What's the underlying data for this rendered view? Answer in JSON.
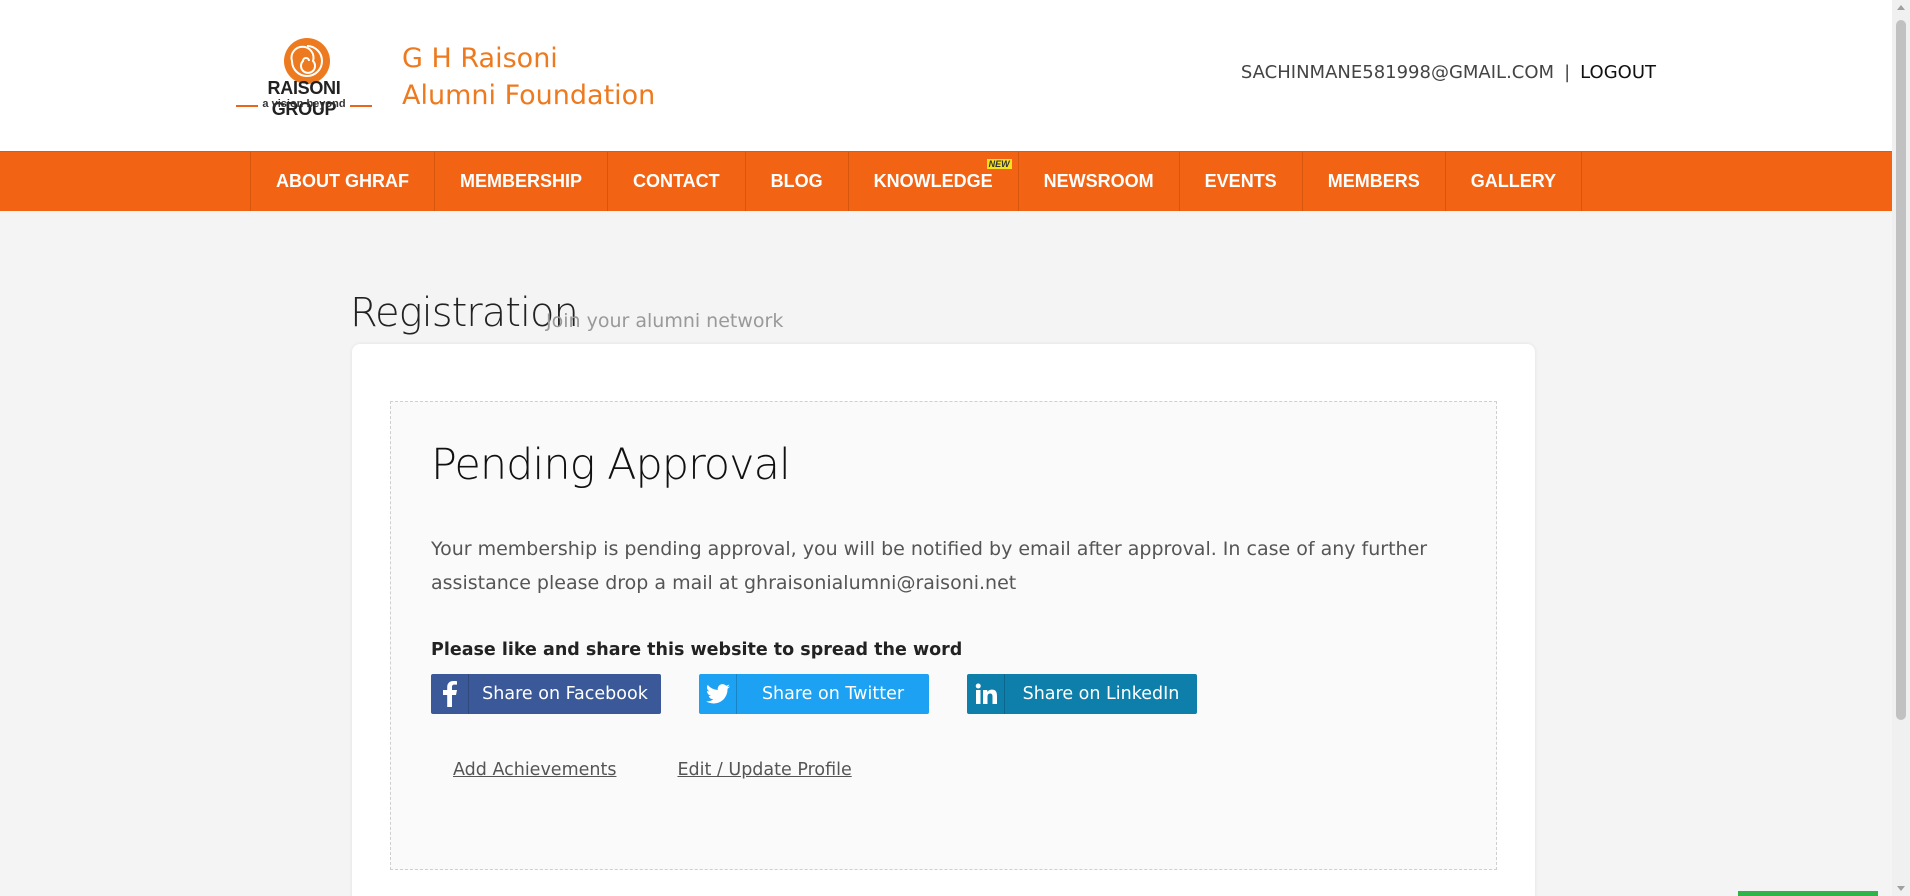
{
  "header": {
    "logo_group": "RAISONI GROUP",
    "logo_tagline": "a vision beyond",
    "brand_line1": "G H Raisoni",
    "brand_line2": "Alumni Foundation",
    "user_email": "SACHINMANE581998@GMAIL.COM",
    "separator": "|",
    "logout_label": "LOGOUT"
  },
  "nav": {
    "items": [
      {
        "label": "ABOUT GHRAF"
      },
      {
        "label": "MEMBERSHIP"
      },
      {
        "label": "CONTACT"
      },
      {
        "label": "BLOG"
      },
      {
        "label": "KNOWLEDGE",
        "badge": "NEW"
      },
      {
        "label": "NEWSROOM"
      },
      {
        "label": "EVENTS"
      },
      {
        "label": "MEMBERS"
      },
      {
        "label": "GALLERY"
      }
    ]
  },
  "page": {
    "title": "Registration",
    "subtitle": "Join your alumni network"
  },
  "status": {
    "title": "Pending Approval",
    "message": "Your membership is pending approval, you will be notified by email after approval. In case of any further assistance please drop a mail at ghraisonialumni@raisoni.net",
    "share_prompt": "Please like and share this website to spread the word"
  },
  "share": {
    "facebook": {
      "label": "Share on Facebook",
      "icon": "facebook-icon",
      "color": "#3b5998"
    },
    "twitter": {
      "label": "Share on Twitter",
      "icon": "twitter-icon",
      "color": "#1da1f2"
    },
    "linkedin": {
      "label": "Share on LinkedIn",
      "icon": "linkedin-icon",
      "color": "#0e7fab"
    }
  },
  "links": {
    "add_achievements": "Add Achievements",
    "edit_profile": "Edit / Update Profile"
  },
  "colors": {
    "nav_bg": "#f26413",
    "brand": "#ee7a1f"
  }
}
